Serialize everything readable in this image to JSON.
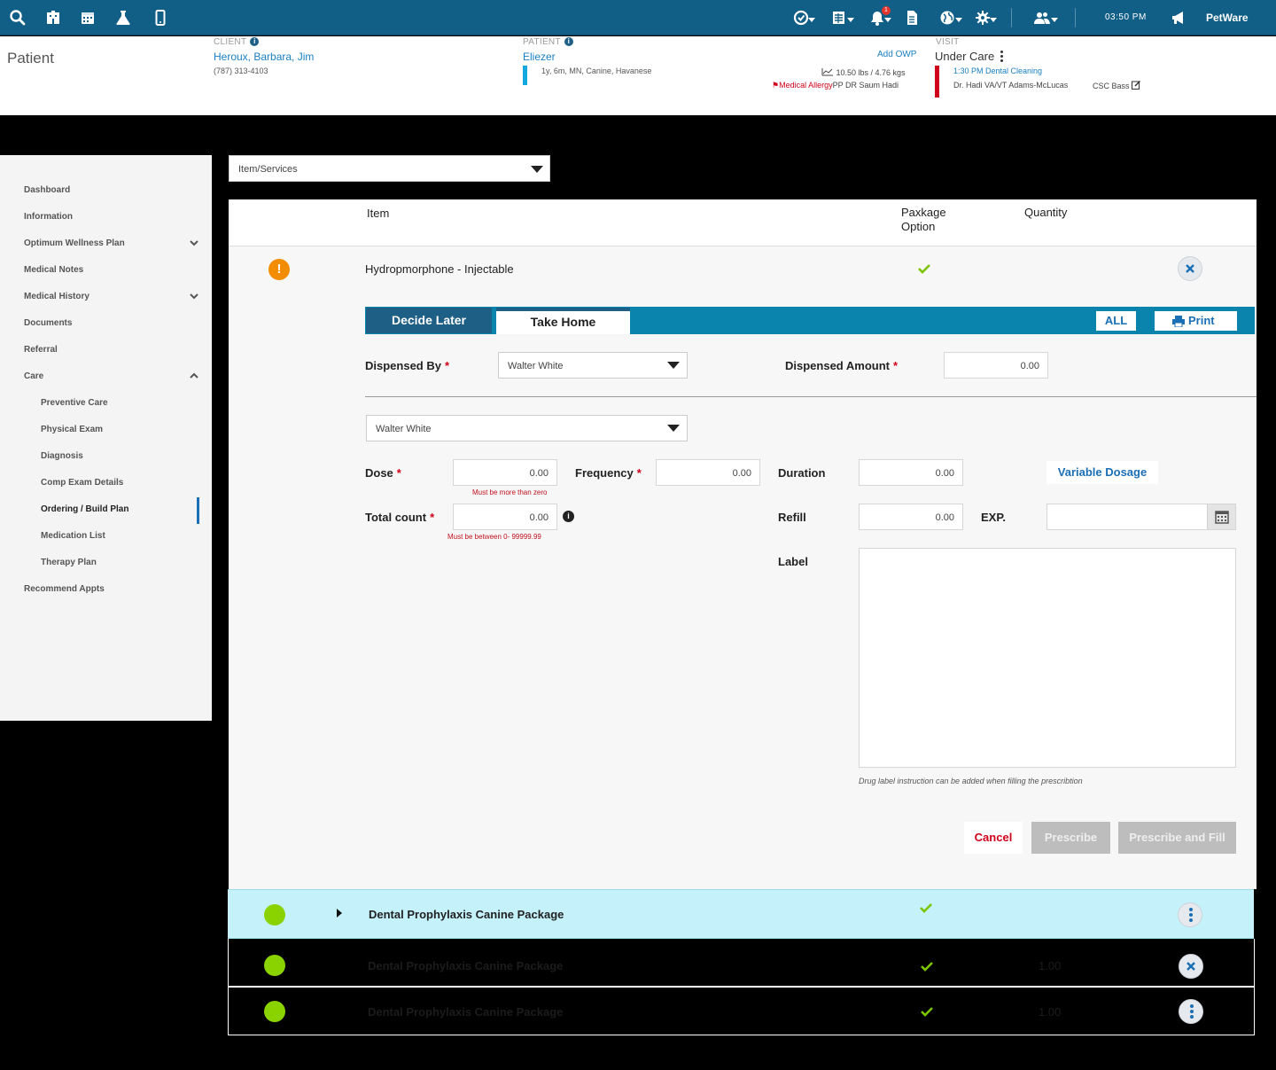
{
  "topbar": {
    "clock": "03:50 PM",
    "brand": "PetWare",
    "notification_count": "1",
    "icons": [
      "search-icon",
      "hospital-icon",
      "calendar-icon",
      "flask-icon",
      "mobile-icon",
      "check-clock-icon",
      "ledger-icon",
      "bell-icon",
      "document-icon",
      "globe-icon",
      "gear-icon",
      "users-icon",
      "megaphone-icon"
    ]
  },
  "header": {
    "page_title": "Patient",
    "client_label": "CLIENT",
    "client_name": "Heroux, Barbara, Jim",
    "client_phone": "(787) 313-4103",
    "patient_label": "PATIENT",
    "patient_name": "Eliezer",
    "patient_details": "1y, 6m, MN, Canine, Havanese",
    "add_owp": "Add OWP",
    "weight": "10.50 lbs / 4.76 kgs",
    "medical_allergy": "Medical Allergy",
    "pp_doctor": "PP DR Saum Hadi",
    "visit_label": "VISIT",
    "visit_status": "Under Care",
    "visit_appt": "1:30 PM Dental Cleaning",
    "visit_staff": "Dr. Hadi VA/VT Adams-McLucas",
    "csc": "CSC Bass"
  },
  "sidebar": {
    "items": [
      {
        "label": "Dashboard"
      },
      {
        "label": "Information"
      },
      {
        "label": "Optimum Wellness Plan"
      },
      {
        "label": "Medical Notes"
      },
      {
        "label": "Medical History"
      },
      {
        "label": "Documents"
      },
      {
        "label": "Referral"
      },
      {
        "label": "Care"
      },
      {
        "label": "Preventive Care"
      },
      {
        "label": "Physical Exam"
      },
      {
        "label": "Diagnosis"
      },
      {
        "label": "Comp Exam Details"
      },
      {
        "label": "Ordering / Build Plan"
      },
      {
        "label": "Medication List"
      },
      {
        "label": "Therapy Plan"
      },
      {
        "label": "Recommend Appts"
      }
    ]
  },
  "filter": {
    "selected": "Item/Services"
  },
  "table": {
    "col_item": "Item",
    "col_package_line1": "Paxkage",
    "col_package_line2": "Option",
    "col_quantity": "Quantity"
  },
  "expanded_item": {
    "name": "Hydropmorphone - Injectable",
    "tabs": {
      "decide_later": "Decide Later",
      "take_home": "Take Home"
    },
    "btn_all": "ALL",
    "btn_print": "Print",
    "dispensed_by_label": "Dispensed By",
    "dispensed_by_value": "Walter White",
    "dispensed_amount_label": "Dispensed Amount",
    "dispensed_amount_value": "0.00",
    "prescriber_value": "Walter White",
    "dose_label": "Dose",
    "dose_value": "0.00",
    "dose_error": "Must be more than zero",
    "frequency_label": "Frequency",
    "frequency_value": "0.00",
    "duration_label": "Duration",
    "duration_value": "0.00",
    "variable_dosage": "Variable Dosage",
    "total_count_label": "Total count",
    "total_count_value": "0.00",
    "total_count_error": "Must be  between  0- 99999.99",
    "refill_label": "Refill",
    "refill_value": "0.00",
    "exp_label": "EXP.",
    "exp_value": "",
    "label_label": "Label",
    "label_hint": "Drug label  instruction can be added when filling the prescribtion",
    "btn_cancel": "Cancel",
    "btn_prescribe": "Prescribe",
    "btn_prescribe_fill": "Prescribe and Fill"
  },
  "rows": [
    {
      "name": "Dental Prophylaxis Canine Package",
      "quantity": ""
    },
    {
      "name": "Dental Prophylaxis Canine Package",
      "quantity": "1.00"
    },
    {
      "name": "Dental Prophylaxis Canine Package",
      "quantity": "1.00"
    }
  ],
  "colors": {
    "topbar": "#115e87",
    "tab_bar": "#0a84ad",
    "tab_dark": "#1d5f85",
    "status_green": "#8bd300",
    "warning_orange": "#f28c00",
    "highlight_row": "#c4f1fa",
    "required_red": "#d0021b"
  }
}
